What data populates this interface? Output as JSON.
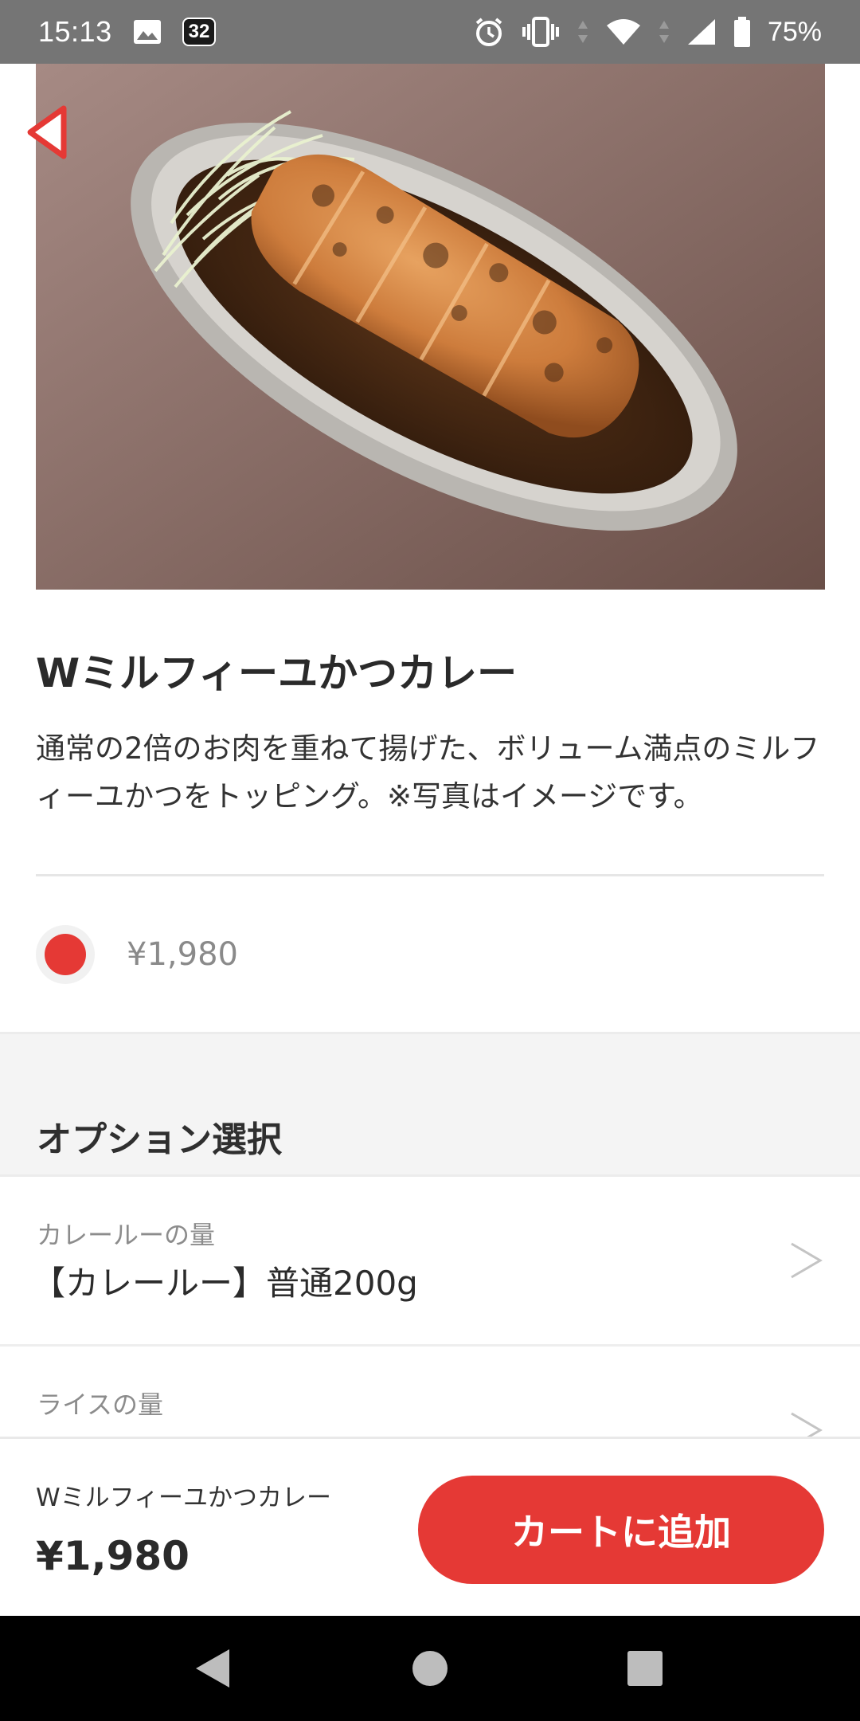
{
  "status_bar": {
    "time": "15:13",
    "notification_badge": "32",
    "battery_percent": "75%",
    "icons": [
      "image-icon",
      "alarm-icon",
      "vibrate-icon",
      "wifi-icon",
      "signal-icon",
      "battery-icon"
    ]
  },
  "product": {
    "title": "Wミルフィーユかつカレー",
    "description": "通常の2倍のお肉を重ねて揚げた、ボリューム満点のミルフィーユかつをトッピング。※写真はイメージです。",
    "price_option": "¥1,980",
    "image_subject": "breaded pork cutlet curry on oval plate with shredded cabbage"
  },
  "options": {
    "section_title": "オプション選択",
    "items": [
      {
        "label": "カレールーの量",
        "value": "【カレールー】普通200g"
      },
      {
        "label": "ライスの量",
        "value": ""
      }
    ]
  },
  "cart": {
    "item_name": "Wミルフィーユかつカレー",
    "total": "¥1,980",
    "add_button_label": "カートに追加"
  },
  "colors": {
    "accent": "#e53935",
    "status_bar": "#757575",
    "section_bg": "#f4f4f4"
  }
}
